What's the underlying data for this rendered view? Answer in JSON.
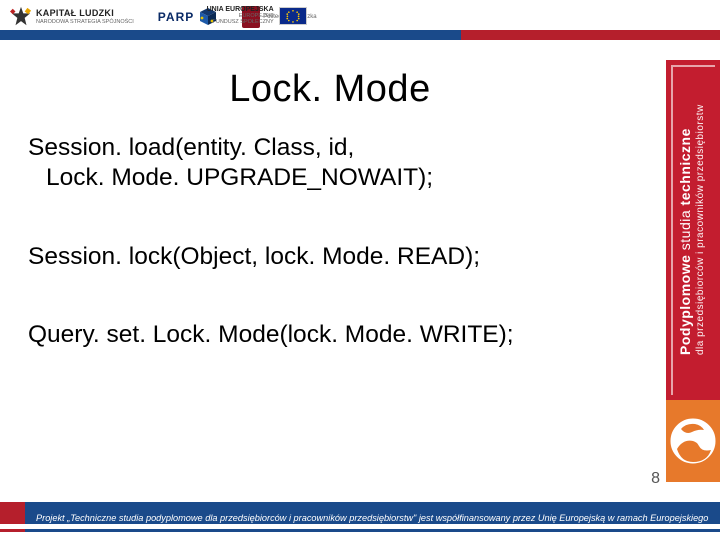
{
  "header": {
    "kapital_title": "KAPITAŁ LUDZKI",
    "kapital_sub": "NARODOWA STRATEGIA SPÓJNOŚCI",
    "parp_label": "PARP",
    "poli_label": "Politechnika Łódzka",
    "eu_title": "UNIA EUROPEJSKA",
    "eu_sub": "EUROPEJSKI\nFUNDUSZ SPOŁECZNY"
  },
  "sidebar": {
    "line1_bold": "Podyplomowe ",
    "line1_rest": "studia ",
    "line1_accent": "techniczne",
    "line2": "dla przedsiębiorców i pracowników przedsiębiorstw",
    "globe_name": "globe-icon"
  },
  "content": {
    "title": "Lock. Mode",
    "line1a": "Session. load(entity. Class, id,",
    "line1b": "Lock. Mode. UPGRADE_NOWAIT);",
    "line2": "Session. lock(Object, lock. Mode. READ);",
    "line3": "Query. set. Lock. Mode(lock. Mode. WRITE);"
  },
  "page_number": "8",
  "footer": {
    "text": "Projekt „Techniczne studia podyplomowe dla przedsiębiorców i pracowników przedsiębiorstw\" jest współfinansowany przez Unię Europejską w ramach Europejskiego Funduszu Społecznego."
  },
  "colors": {
    "navy": "#1a4a8a",
    "red": "#b51f2c",
    "sidebar_red": "#c31d2f",
    "orange": "#e7792b"
  }
}
